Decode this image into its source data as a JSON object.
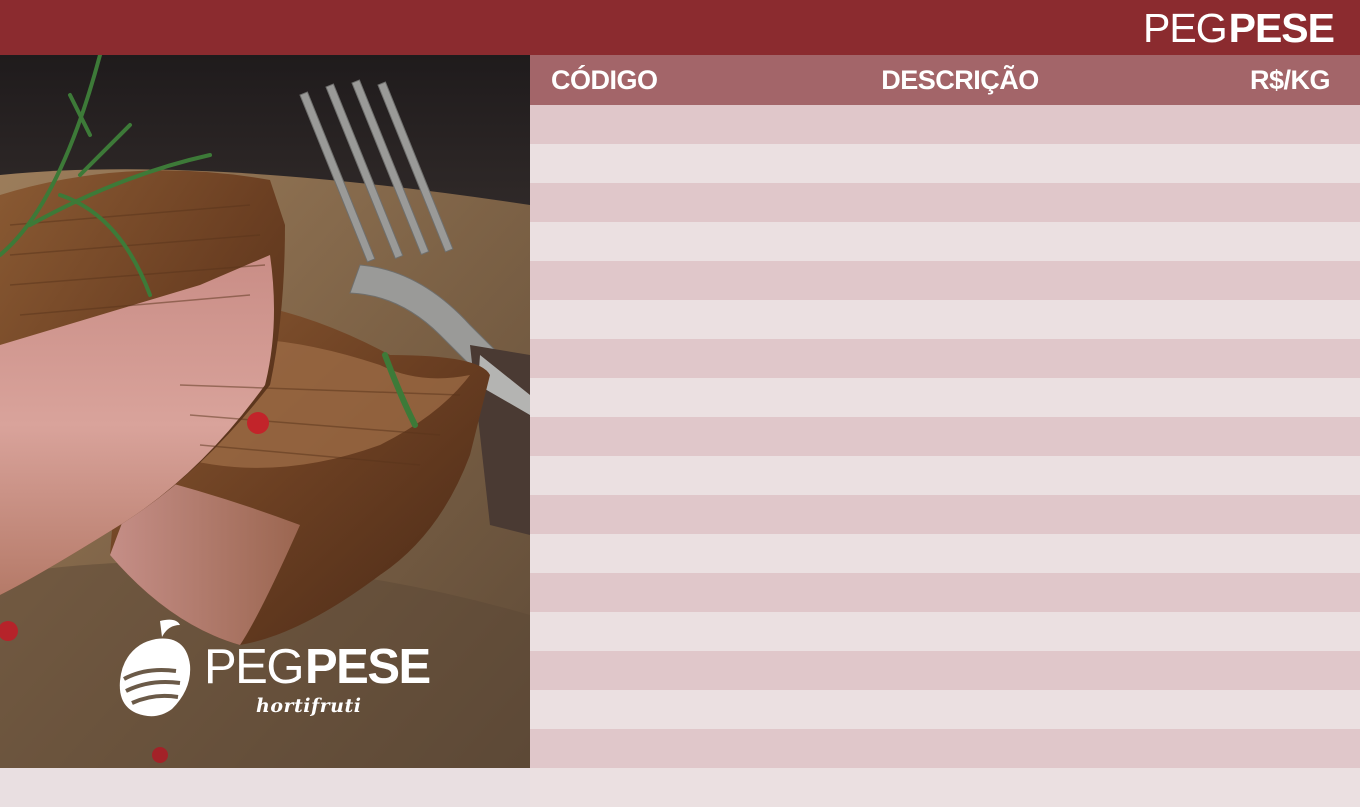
{
  "header": {
    "brand": {
      "part1": "PEG",
      "part2": "PESE"
    },
    "brand_color": "#8b2b2f"
  },
  "hero": {
    "image_subject": "grilled-steak-with-rosemary-and-fork",
    "logo": {
      "part1": "PEG",
      "part2": "PESE",
      "tagline": "hortifruti",
      "emblem": "hands-with-fruit-icon"
    }
  },
  "table": {
    "columns": [
      "CÓDIGO",
      "DESCRIÇÃO",
      "R$/KG"
    ],
    "header_color": "#a36569",
    "stripe_colors": [
      "#e0c7ca",
      "#ebe0e1"
    ],
    "rows": [
      {
        "codigo": "",
        "descricao": "",
        "preco": ""
      },
      {
        "codigo": "",
        "descricao": "",
        "preco": ""
      },
      {
        "codigo": "",
        "descricao": "",
        "preco": ""
      },
      {
        "codigo": "",
        "descricao": "",
        "preco": ""
      },
      {
        "codigo": "",
        "descricao": "",
        "preco": ""
      },
      {
        "codigo": "",
        "descricao": "",
        "preco": ""
      },
      {
        "codigo": "",
        "descricao": "",
        "preco": ""
      },
      {
        "codigo": "",
        "descricao": "",
        "preco": ""
      },
      {
        "codigo": "",
        "descricao": "",
        "preco": ""
      },
      {
        "codigo": "",
        "descricao": "",
        "preco": ""
      },
      {
        "codigo": "",
        "descricao": "",
        "preco": ""
      },
      {
        "codigo": "",
        "descricao": "",
        "preco": ""
      },
      {
        "codigo": "",
        "descricao": "",
        "preco": ""
      },
      {
        "codigo": "",
        "descricao": "",
        "preco": ""
      },
      {
        "codigo": "",
        "descricao": "",
        "preco": ""
      },
      {
        "codigo": "",
        "descricao": "",
        "preco": ""
      },
      {
        "codigo": "",
        "descricao": "",
        "preco": ""
      },
      {
        "codigo": "",
        "descricao": "",
        "preco": ""
      }
    ]
  }
}
